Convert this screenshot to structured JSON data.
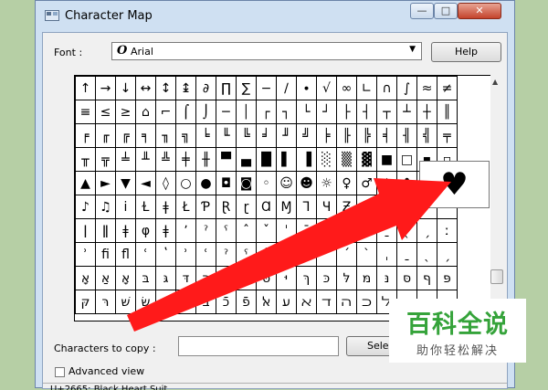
{
  "window": {
    "title": "Character Map",
    "buttons": {
      "minimize": "—",
      "maximize": "□",
      "close": "✕"
    }
  },
  "font": {
    "label": "Font :",
    "selected": "Arial",
    "help_label": "Help"
  },
  "grid": {
    "rows": [
      [
        "↑",
        "→",
        "↓",
        "↔",
        "↕",
        "↨",
        "∂",
        "∏",
        "∑",
        "−",
        "∕",
        "∙",
        "√",
        "∞",
        "∟",
        "∩",
        "∫",
        "≈",
        "≠"
      ],
      [
        "≡",
        "≤",
        "≥",
        "⌂",
        "⌐",
        "⌠",
        "⌡",
        "─",
        "│",
        "┌",
        "┐",
        "└",
        "┘",
        "├",
        "┤",
        "┬",
        "┴",
        "┼",
        "║"
      ],
      [
        "╒",
        "╓",
        "╔",
        "╕",
        "╖",
        "╗",
        "╘",
        "╙",
        "╚",
        "╛",
        "╜",
        "╝",
        "╞",
        "╟",
        "╠",
        "╡",
        "╢",
        "╣",
        "╤"
      ],
      [
        "╥",
        "╦",
        "╧",
        "╨",
        "╩",
        "╪",
        "╫",
        "▀",
        "▄",
        "█",
        "▌",
        "▐",
        "░",
        "▒",
        "▓",
        "■",
        "□",
        "▪",
        "▫"
      ],
      [
        "▲",
        "►",
        "▼",
        "◄",
        "◊",
        "○",
        "●",
        "◘",
        "◙",
        "◦",
        "☺",
        "☻",
        "☼",
        "♀",
        "♂",
        "♠",
        "♣",
        "♥",
        "♦"
      ],
      [
        "♪",
        "♫",
        "ⅰ",
        "Ɫ",
        "ǂ",
        "Ł",
        "Ƥ",
        "Ɽ",
        "ɽ",
        "Ɑ",
        "Ɱ",
        "Ꞁ",
        "Ɥ",
        "Ƶ",
        "ƶ",
        "ǂ",
        "ǃ",
        "ʼ",
        "ˇ"
      ],
      [
        "ǀ",
        "ǁ",
        "ǂ",
        "φ",
        "ǂ",
        "ʼ",
        "ˀ",
        "ˁ",
        "ˆ",
        "ˇ",
        "ˈ",
        "ˉ",
        "ˊ",
        "ˋ",
        "ˌ",
        "ˍ",
        "ˎ",
        "ˏ",
        "ː"
      ],
      [
        "ʾ",
        "ﬁ",
        "ﬂ",
        "ʿ",
        "ʽ",
        "ʾ",
        "ʿ",
        "ˀ",
        "ˁ",
        "ˆ",
        "ˇ",
        "ˈ",
        "ˉ",
        "ˊ",
        "ˋ",
        "ˌ",
        "ˍ",
        "ˎ",
        "ˏ"
      ],
      [
        "אָ",
        "אַ",
        "אָ",
        "בּ",
        "גּ",
        "דּ",
        "הּ",
        "וּ",
        "זּ",
        "טּ",
        "יּ",
        "ךּ",
        "כּ",
        "לּ",
        "מּ",
        "נּ",
        "סּ",
        "ףּ",
        "פּ"
      ],
      [
        "קּ",
        "רּ",
        "שּׁ",
        "שּׂ",
        "תּ",
        "וֹ",
        "בֿ",
        "כֿ",
        "פֿ",
        "ﭏ",
        "ﬠ",
        "ﬡ",
        "ﬢ",
        "ﬣ",
        "ﬤ",
        "ﬥ",
        "ﬦ",
        "ﬧ",
        "ﬨ"
      ]
    ],
    "popup_char": "♥"
  },
  "copy": {
    "label": "Characters to copy :",
    "value": "",
    "select_label": "Select"
  },
  "advanced": {
    "label": "Advanced view"
  },
  "status": {
    "text": "U+2665: Black Heart Suit"
  },
  "watermark": {
    "title": "百科全说",
    "subtitle": "助你轻松解决"
  },
  "colors": {
    "arrow": "#ff1a1a",
    "watermark_green": "#35a33a",
    "desktop": "#b6cfa5"
  }
}
